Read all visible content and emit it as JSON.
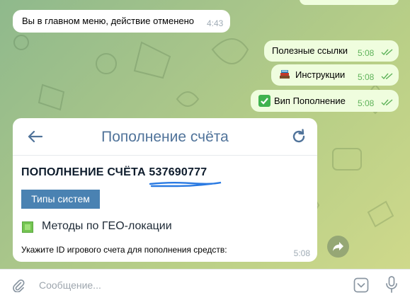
{
  "messages": {
    "incoming_1": {
      "text": "Вы в главном меню, действие отменено",
      "time": "4:43"
    },
    "outgoing": [
      {
        "text": "Полезные ссылки",
        "time": "5:08"
      },
      {
        "icon": "books-icon",
        "text": "Инструкции",
        "time": "5:08"
      },
      {
        "icon": "check-mark-emoji-icon",
        "text": "Вип Пополнение",
        "time": "5:08"
      }
    ]
  },
  "card": {
    "title": "Пополнение счёта",
    "heading_prefix": "ПОПОЛНЕНИЕ СЧЁТА",
    "account_id": "537690777",
    "types_button": "Типы систем",
    "geo_label": "Методы по ГЕО-локации",
    "prompt": "Укажите ID игрового счета для пополнения средств:",
    "time": "5:08"
  },
  "input": {
    "placeholder": "Сообщение..."
  },
  "colors": {
    "outgoing_bubble": "#effdde",
    "time_outgoing": "#5fb35a",
    "accent": "#50739a",
    "button": "#4a82b2",
    "underline": "#2a7ae2"
  }
}
